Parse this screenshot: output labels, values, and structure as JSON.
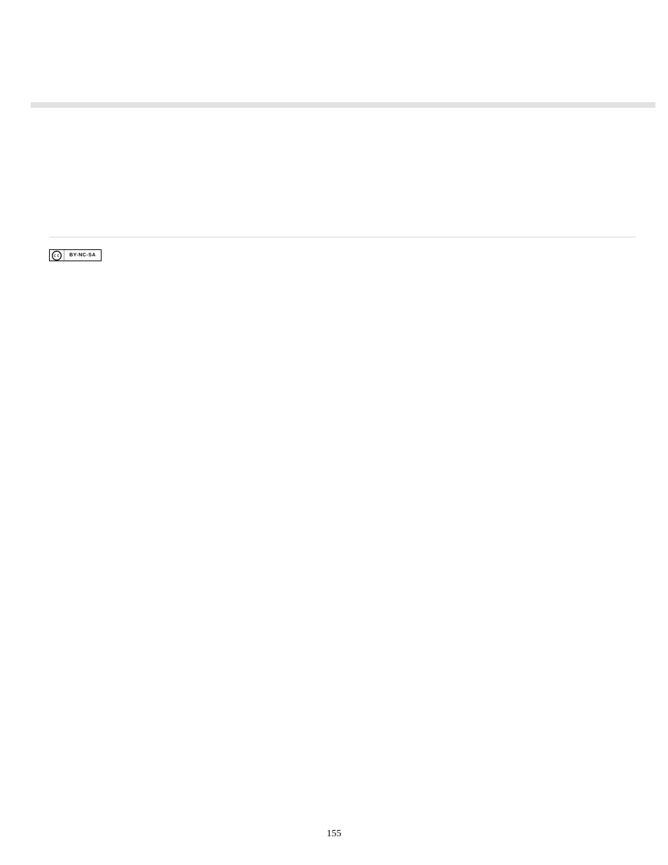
{
  "cc_badge": {
    "label": "BY-NC-SA"
  },
  "page_number": "155"
}
